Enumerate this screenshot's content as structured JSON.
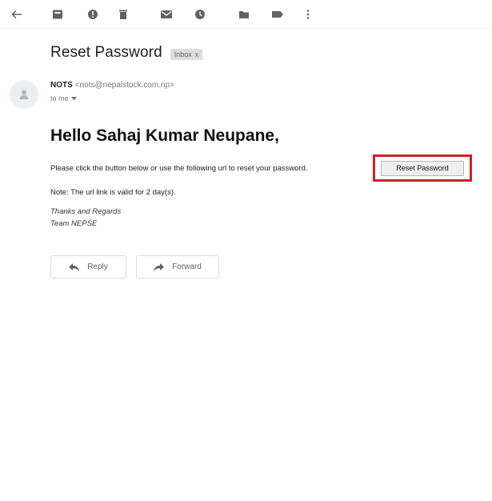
{
  "toolbar": {
    "icons": [
      "back-arrow-icon",
      "archive-icon",
      "report-spam-icon",
      "delete-icon",
      "mark-unread-icon",
      "snooze-icon",
      "move-to-icon",
      "label-icon",
      "more-icon"
    ]
  },
  "message": {
    "subject": "Reset Password",
    "label": "Inbox",
    "label_close": "x",
    "sender_name": "NOTS",
    "sender_email": "<nots@nepalstock.com.np>",
    "to": "to me",
    "greeting": "Hello Sahaj Kumar Neupane,",
    "instruction": "Please click the button below or use the following url to reset your password.",
    "reset_button": "Reset Password",
    "note": "Note: The url link is valid for 2 day(s).",
    "signoff_1": "Thanks and Regards",
    "signoff_2": "Team NEPSE"
  },
  "actions": {
    "reply": "Reply",
    "forward": "Forward"
  },
  "colors": {
    "highlight_border": "#d0202a",
    "icon": "#5f6368"
  }
}
